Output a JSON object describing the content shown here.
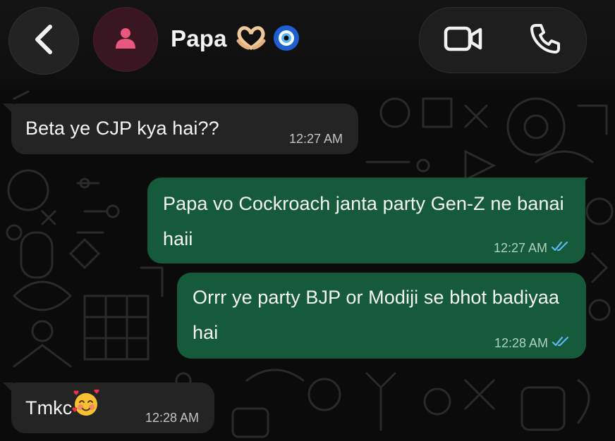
{
  "header": {
    "contact_name": "Papa",
    "name_emojis": [
      "heart-hands-icon",
      "nazar-amulet-icon"
    ]
  },
  "messages": [
    {
      "direction": "incoming",
      "text": "Beta ye CJP kya hai??",
      "time": "12:27 AM"
    },
    {
      "direction": "outgoing",
      "text": "Papa vo Cockroach janta party Gen-Z ne banai haii",
      "time": "12:27 AM",
      "status": "read"
    },
    {
      "direction": "outgoing",
      "text": "Orrr ye party BJP or Modiji se bhot badiyaa hai",
      "time": "12:28 AM",
      "status": "read"
    },
    {
      "direction": "incoming",
      "text": "Tmkc",
      "emoji": "smiling-face-with-hearts-icon",
      "time": "12:28 AM"
    }
  ],
  "colors": {
    "background": "#0b0b0b",
    "incoming_bubble": "#242424",
    "outgoing_bubble": "#155a3a",
    "read_ticks": "#5eb7f0",
    "avatar_accent": "#e8577f"
  }
}
